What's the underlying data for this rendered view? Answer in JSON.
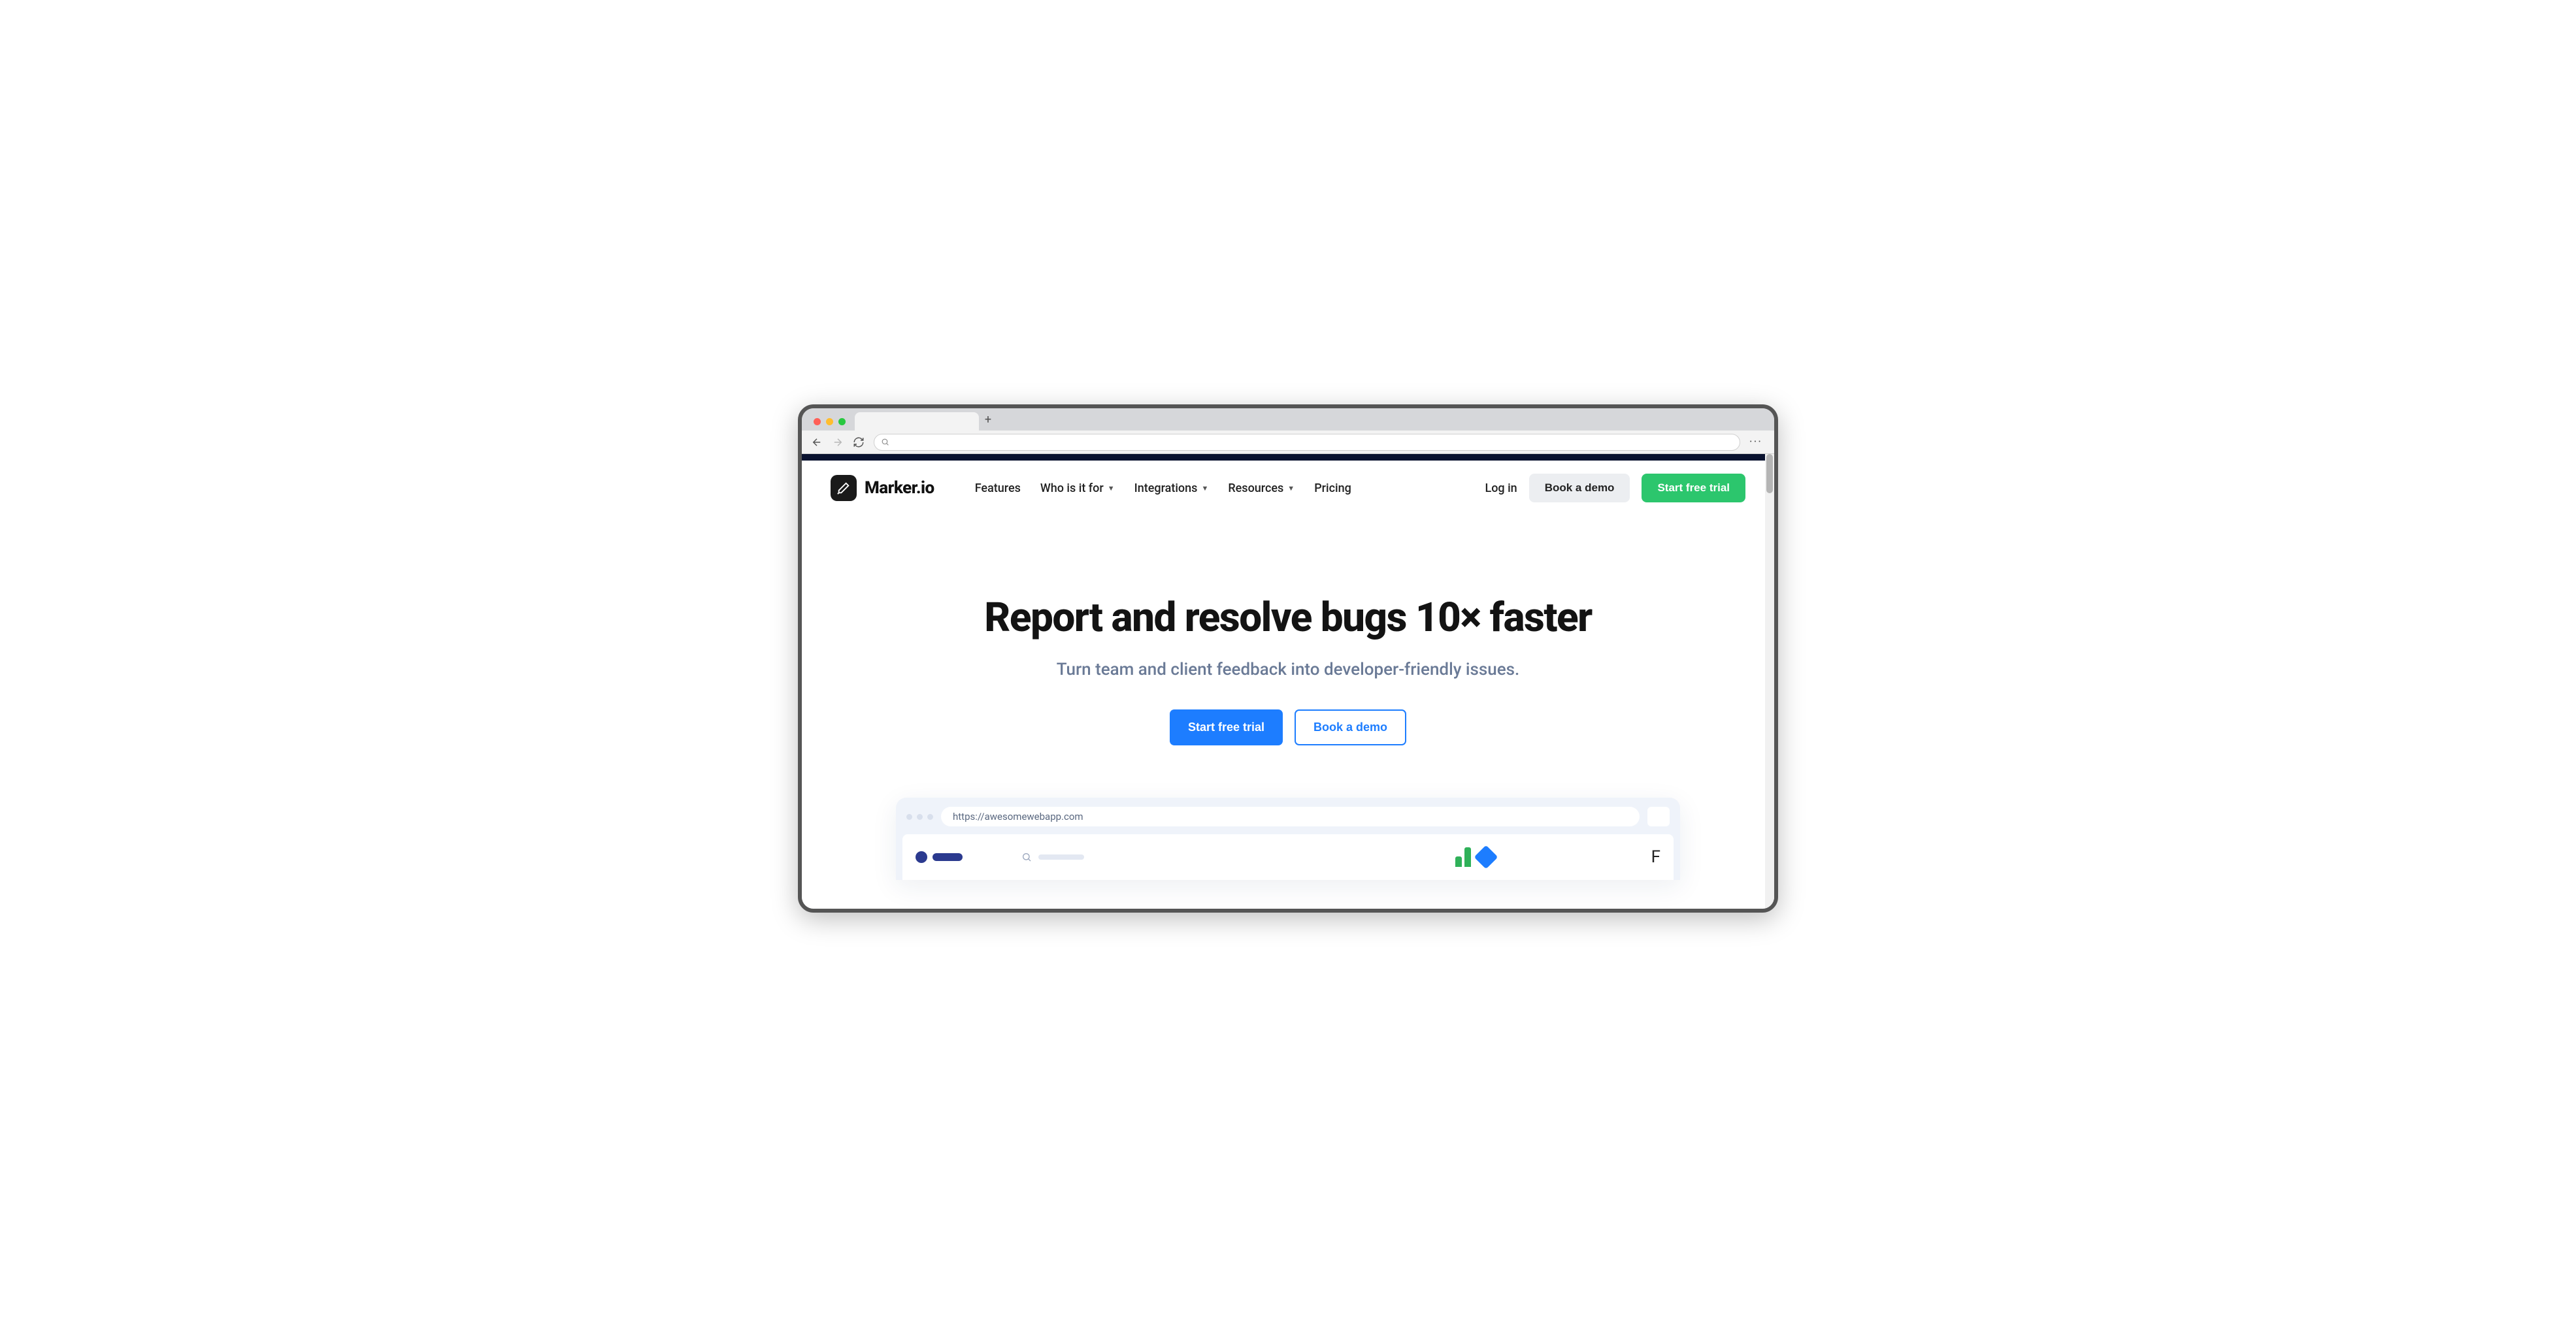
{
  "browser": {
    "newtab_glyph": "+",
    "more_glyph": "···"
  },
  "header": {
    "logo_text": "Marker.io",
    "nav": [
      {
        "label": "Features",
        "dropdown": false
      },
      {
        "label": "Who is it for",
        "dropdown": true
      },
      {
        "label": "Integrations",
        "dropdown": true
      },
      {
        "label": "Resources",
        "dropdown": true
      },
      {
        "label": "Pricing",
        "dropdown": false
      }
    ],
    "login": "Log in",
    "demo": "Book a demo",
    "trial": "Start free trial"
  },
  "hero": {
    "title": "Report and resolve bugs 10× faster",
    "subtitle": "Turn team and client feedback into developer-friendly issues.",
    "cta_primary": "Start free trial",
    "cta_secondary": "Book a demo"
  },
  "illus": {
    "url": "https://awesomewebapp.com",
    "sidetext_prefix": "F"
  },
  "colors": {
    "green": "#2cc66d",
    "blue": "#1d7dff",
    "navy": "#0a1330",
    "muted": "#6a7a96"
  }
}
